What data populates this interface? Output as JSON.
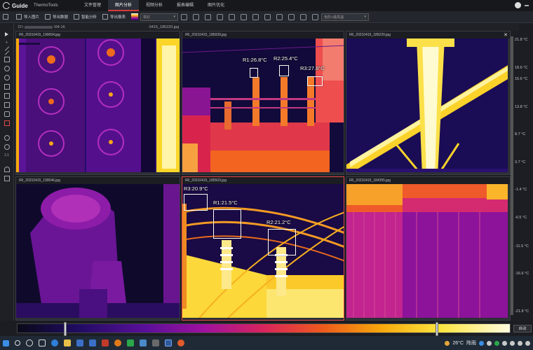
{
  "app": {
    "logo_text": "Guide",
    "name": "ThermoTools"
  },
  "menu": [
    {
      "label": "文件管理"
    },
    {
      "label": "图片分析"
    },
    {
      "label": "视频分析"
    },
    {
      "label": "报表编辑"
    },
    {
      "label": "图片优化"
    }
  ],
  "toolbar": {
    "import_label": "导入图片",
    "export_data_label": "导出数据",
    "smart_analysis_label": "智能分析",
    "export_report_label": "导出报表",
    "palette_select": "铁红",
    "combo_select": "色阶+最高温"
  },
  "path": {
    "prefix": "D:\\",
    "middle": "\\04-16",
    "suffix": "0415_185220.jpg"
  },
  "panes": [
    {
      "caption": "IRI_20210415_190004.jpg"
    },
    {
      "caption": "IRI_20210415_185939.jpg"
    },
    {
      "caption": "IRI_20210415_185220.jpg"
    },
    {
      "caption": "IRI_20210415_190046.jpg"
    },
    {
      "caption": "IRI_20210415_185503.jpg"
    },
    {
      "caption": "IRI_20210415_184355.jpg"
    }
  ],
  "measurements": {
    "p2_r1": "R1:26.8°C",
    "p2_r2": "R2:25.4°C",
    "p2_r3": "R3:27.8°C",
    "p5_r3": "R3:20.9°C",
    "p5_r1": "R1:21.5°C",
    "p5_r2": "R2:21.2°C"
  },
  "scale": {
    "top": "21.8 °C",
    "labels": [
      "21.8 °C",
      "18.6 °C",
      "15.6 °C",
      "13.8 °C",
      "8.7 °C",
      "3.7 °C",
      "-1.4 °C",
      "-6.5 °C",
      "-11.5 °C",
      "-16.6 °C",
      "-21.8 °C"
    ],
    "bottom": "21.8 °C"
  },
  "lefttools": {
    "ratio_label": "1:1"
  },
  "palette": {
    "auto_label": "自动"
  },
  "taskbar": {
    "temperature": "26°C",
    "weather": "阵雨"
  },
  "colors": {
    "accent": "#d53b3b",
    "bg": "#1b1d22"
  }
}
